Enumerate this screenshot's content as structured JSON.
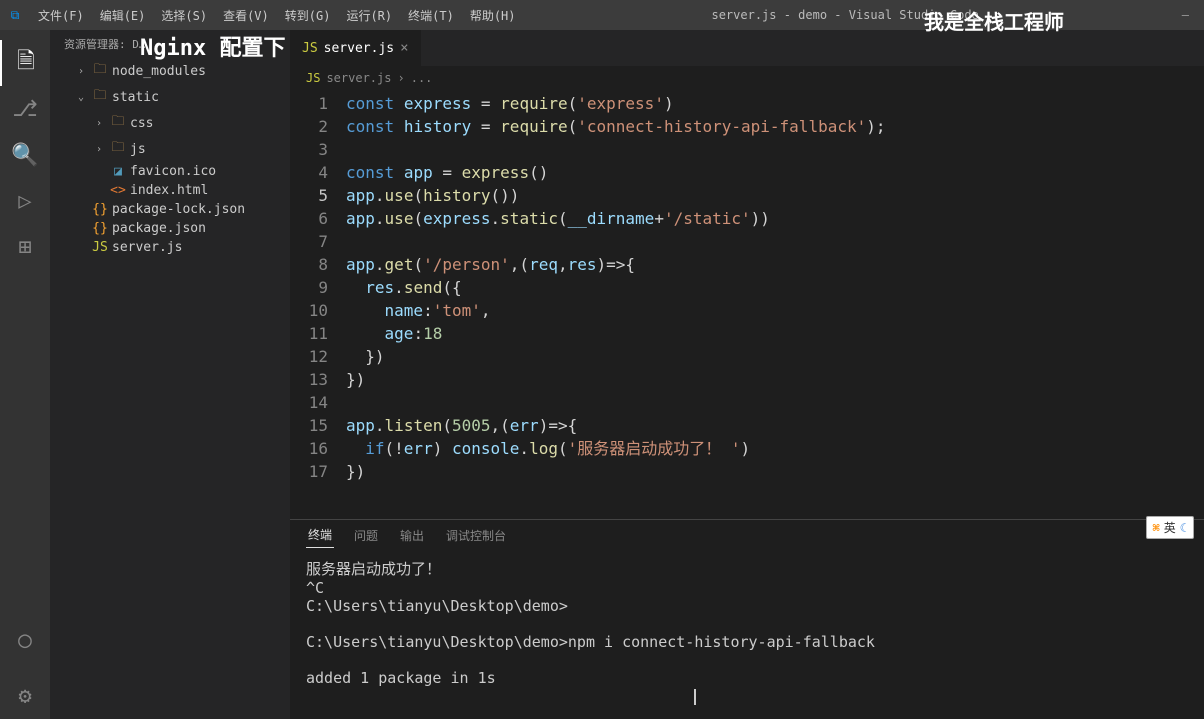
{
  "titlebar": {
    "menus": [
      "文件(F)",
      "编辑(E)",
      "选择(S)",
      "查看(V)",
      "转到(G)",
      "运行(R)",
      "终端(T)",
      "帮助(H)"
    ],
    "title": "server.js - demo - Visual Studio Code"
  },
  "overlays": {
    "right": "我是全栈工程师",
    "left": "Nginx 配置下"
  },
  "sidebar": {
    "header": "资源管理器: D…",
    "items": [
      {
        "type": "folder",
        "label": "node_modules",
        "indent": 1,
        "open": false,
        "chev": "›"
      },
      {
        "type": "folder",
        "label": "static",
        "indent": 1,
        "open": true,
        "chev": "⌄"
      },
      {
        "type": "folder",
        "label": "css",
        "indent": 2,
        "open": false,
        "chev": "›"
      },
      {
        "type": "folder",
        "label": "js",
        "indent": 2,
        "open": false,
        "chev": "›"
      },
      {
        "type": "file-ico",
        "label": "favicon.ico",
        "indent": 2,
        "icon": "◪"
      },
      {
        "type": "file-html",
        "label": "index.html",
        "indent": 2,
        "icon": "<>"
      },
      {
        "type": "file-json",
        "label": "package-lock.json",
        "indent": 1,
        "icon": "{}"
      },
      {
        "type": "file-json",
        "label": "package.json",
        "indent": 1,
        "icon": "{}"
      },
      {
        "type": "file-js",
        "label": "server.js",
        "indent": 1,
        "icon": "JS"
      }
    ]
  },
  "tabs": {
    "items": [
      {
        "label": "server.js",
        "active": true
      }
    ]
  },
  "breadcrumb": {
    "file": "server.js",
    "sep": "›",
    "rest": "..."
  },
  "code": {
    "lines": [
      {
        "n": 1,
        "html": "<span class='k'>const</span> <span class='v'>express</span> <span class='c'>=</span> <span class='f'>require</span><span class='c'>(</span><span class='s'>'express'</span><span class='c'>)</span>"
      },
      {
        "n": 2,
        "html": "<span class='k'>const</span> <span class='v'>history</span> <span class='c'>=</span> <span class='f'>require</span><span class='c'>(</span><span class='s'>'connect-history-api-fallback'</span><span class='c'>);</span>"
      },
      {
        "n": 3,
        "html": ""
      },
      {
        "n": 4,
        "html": "<span class='k'>const</span> <span class='v'>app</span> <span class='c'>=</span> <span class='f'>express</span><span class='c'>()</span>"
      },
      {
        "n": 5,
        "html": "<span class='v'>app</span><span class='c'>.</span><span class='f'>use</span><span class='c'>(</span><span class='f'>history</span><span class='c'>())</span>",
        "active": true
      },
      {
        "n": 6,
        "html": "<span class='v'>app</span><span class='c'>.</span><span class='f'>use</span><span class='c'>(</span><span class='v'>express</span><span class='c'>.</span><span class='f'>static</span><span class='c'>(</span><span class='v'>__dirname</span><span class='c'>+</span><span class='s'>'/static'</span><span class='c'>))</span>"
      },
      {
        "n": 7,
        "html": ""
      },
      {
        "n": 8,
        "html": "<span class='v'>app</span><span class='c'>.</span><span class='f'>get</span><span class='c'>(</span><span class='s'>'/person'</span><span class='c'>,(</span><span class='v'>req</span><span class='c'>,</span><span class='v'>res</span><span class='c'>)=&gt;{</span>"
      },
      {
        "n": 9,
        "html": "  <span class='v'>res</span><span class='c'>.</span><span class='f'>send</span><span class='c'>({</span>"
      },
      {
        "n": 10,
        "html": "    <span class='v'>name</span><span class='c'>:</span><span class='s'>'tom'</span><span class='c'>,</span>"
      },
      {
        "n": 11,
        "html": "    <span class='v'>age</span><span class='c'>:</span><span class='n'>18</span>"
      },
      {
        "n": 12,
        "html": "  <span class='c'>})</span>"
      },
      {
        "n": 13,
        "html": "<span class='c'>})</span>"
      },
      {
        "n": 14,
        "html": ""
      },
      {
        "n": 15,
        "html": "<span class='v'>app</span><span class='c'>.</span><span class='f'>listen</span><span class='c'>(</span><span class='n'>5005</span><span class='c'>,(</span><span class='v'>err</span><span class='c'>)=&gt;{</span>"
      },
      {
        "n": 16,
        "html": "  <span class='k'>if</span><span class='c'>(!</span><span class='v'>err</span><span class='c'>)</span> <span class='v'>console</span><span class='c'>.</span><span class='f'>log</span><span class='c'>(</span><span class='s'>'服务器启动成功了！ '</span><span class='c'>)</span>"
      },
      {
        "n": 17,
        "html": "<span class='c'>})</span>"
      }
    ]
  },
  "panel": {
    "tabs": [
      "终端",
      "问题",
      "输出",
      "调试控制台"
    ],
    "active": 0,
    "terminal": "服务器启动成功了！\n^C\nC:\\Users\\tianyu\\Desktop\\demo>\n\nC:\\Users\\tianyu\\Desktop\\demo>npm i connect-history-api-fallback\n\nadded 1 package in 1s\n"
  },
  "ime": {
    "left": "⌘",
    "mid": "英",
    "right": "☾"
  }
}
